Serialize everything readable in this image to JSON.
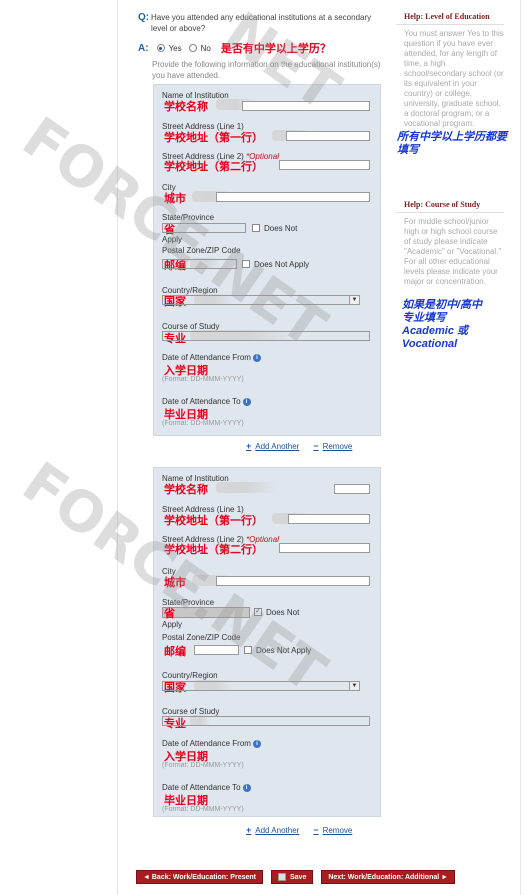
{
  "question": {
    "letter": "Q:",
    "text": "Have you attended any educational institutions at a secondary level or above?"
  },
  "answer": {
    "letter": "A:",
    "options": [
      "Yes",
      "No"
    ],
    "selected": "Yes",
    "annotation": "是否有中学以上学历？"
  },
  "instructions": "Provide the following information on the educational institution(s) you have attended.",
  "form_labels": {
    "name": "Name of Institution",
    "street1": "Street Address (Line 1)",
    "street2": "Street Address (Line 2)",
    "optional": "*Optional",
    "city": "City",
    "state": "State/Province",
    "does_not_apply": "Does Not Apply",
    "does_not": "Does Not",
    "apply": "Apply",
    "postal": "Postal Zone/ZIP Code",
    "country": "Country/Region",
    "course": "Course of Study",
    "date_from": "Date of Attendance From",
    "date_to": "Date of Attendance To",
    "date_format": "(Format: DD-MMM-YYYY)"
  },
  "annotations_zh": {
    "school_name": "学校名称",
    "street1": "学校地址（第一行）",
    "street2": "学校地址（第二行）",
    "city": "城市",
    "state": "省",
    "postal": "邮编",
    "country": "国家",
    "course": "专业",
    "date_from": "入学日期",
    "date_to": "毕业日期"
  },
  "links": {
    "add_another": "Add Another",
    "remove": "Remove"
  },
  "help_level": {
    "prefix": "Help:",
    "title": "Level of Education",
    "body": "You must answer Yes to this question if you have ever attended, for any length of time, a high school/secondary school (or its equivalent in your country) or college, university, graduate school, a doctoral program, or a vocational program."
  },
  "help_course": {
    "prefix": "Help:",
    "title": "Course of Study",
    "body": "For middle school/junior high or high school course of study please indicate \"Academic\" or \"Vocational.\" For all other educational levels please indicate your major or concentration."
  },
  "notes": {
    "all_above": "所有中学以上学历都要填写",
    "course_line1": "如果是初中/高中",
    "course_line2": "专业填写",
    "course_line3": "Academic 或",
    "course_line4": "Vocational"
  },
  "nav": {
    "back": "◄ Back: Work/Education: Present",
    "save": "Save",
    "next": "Next: Work/Education: Additional ►"
  },
  "watermark": "FORCE.NET",
  "colors": {
    "accent_red": "#a81e20",
    "annotation_red": "#e8001c",
    "note_blue": "#1738d6",
    "form_bg": "#dfe6ee"
  }
}
